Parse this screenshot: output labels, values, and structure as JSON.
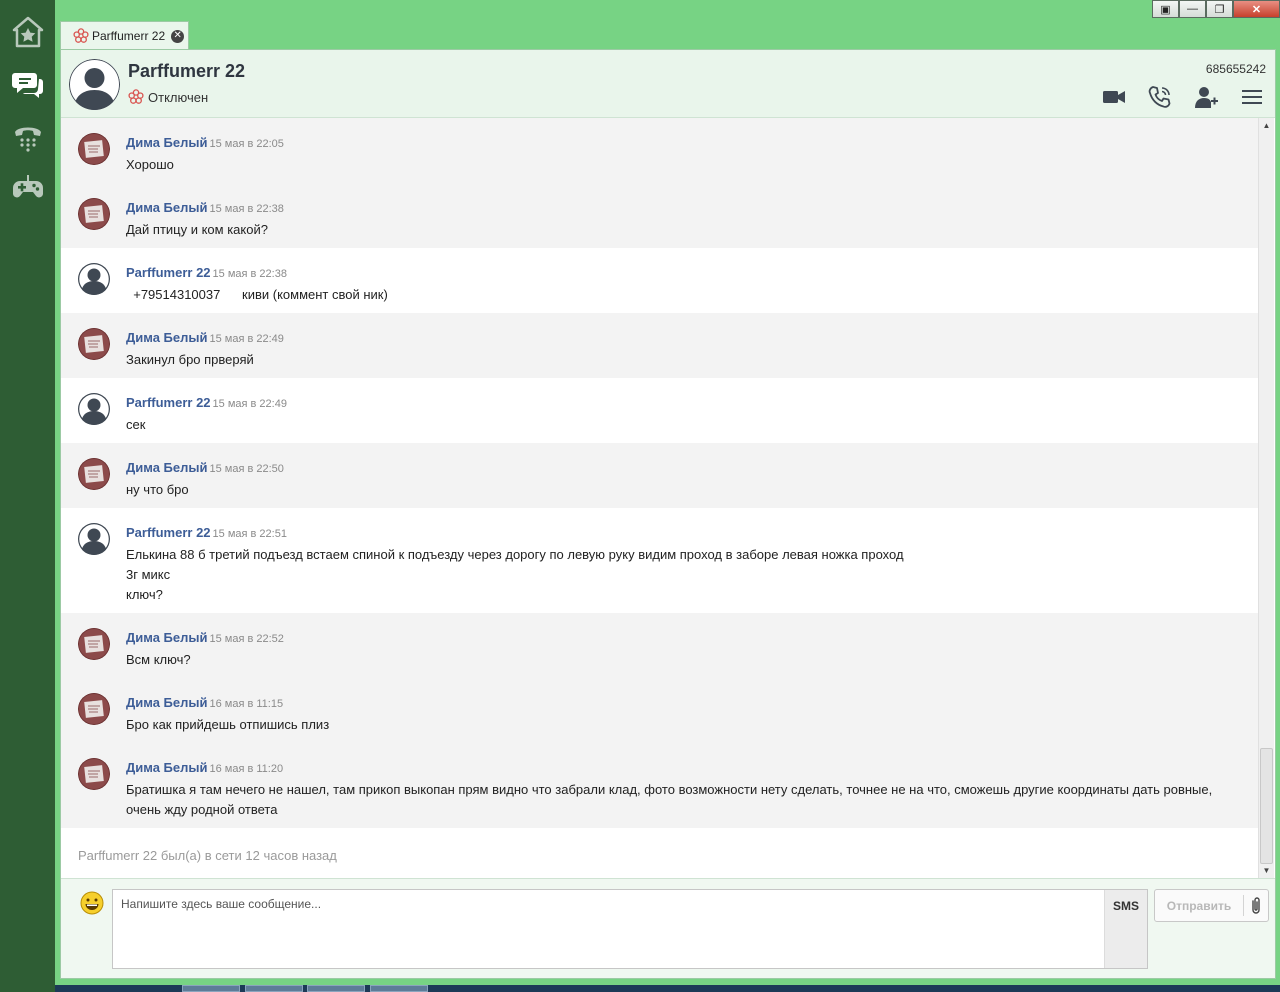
{
  "window": {
    "tab_label": "Parffumerr 22",
    "tab_close_glyph": "✕",
    "controls": [
      "▣",
      "—",
      "❐",
      "✕"
    ]
  },
  "sidebar": {
    "items": [
      {
        "name": "home-icon"
      },
      {
        "name": "chat-icon"
      },
      {
        "name": "phone-icon"
      },
      {
        "name": "gamepad-icon"
      }
    ]
  },
  "header": {
    "name": "Parffumerr 22",
    "status": "Отключен",
    "id": "685655242"
  },
  "messages": [
    {
      "author": "Дима Белый",
      "time": "15 мая в 22:05",
      "lines": [
        "Хорошо"
      ],
      "avatar": "dima"
    },
    {
      "author": "Дима Белый",
      "time": "15 мая в 22:38",
      "lines": [
        "Дай птицу и ком какой?"
      ],
      "avatar": "dima"
    },
    {
      "author": "Parffumerr 22",
      "time": "15 мая в 22:38",
      "lines": [
        "  +79514310037      киви (коммент свой ник)"
      ],
      "avatar": "user"
    },
    {
      "author": "Дима Белый",
      "time": "15 мая в 22:49",
      "lines": [
        "Закинул бро прверяй"
      ],
      "avatar": "dima"
    },
    {
      "author": "Parffumerr 22",
      "time": "15 мая в 22:49",
      "lines": [
        "сек"
      ],
      "avatar": "user"
    },
    {
      "author": "Дима Белый",
      "time": "15 мая в 22:50",
      "lines": [
        "ну что бро"
      ],
      "avatar": "dima"
    },
    {
      "author": "Parffumerr 22",
      "time": "15 мая в 22:51",
      "lines": [
        "Елькина 88 б третий подъезд встаем спиной к подъезду через дорогу по левую руку видим проход в заборе левая ножка проход",
        "3г микс",
        "ключ?"
      ],
      "avatar": "user"
    },
    {
      "author": "Дима Белый",
      "time": "15 мая в 22:52",
      "lines": [
        "Всм ключ?"
      ],
      "avatar": "dima"
    },
    {
      "author": "Дима Белый",
      "time": "16 мая в 11:15",
      "lines": [
        "Бро как прийдешь отпишись плиз"
      ],
      "avatar": "dima"
    },
    {
      "author": "Дима Белый",
      "time": "16 мая в 11:20",
      "lines": [
        "Братишка я там нечего не нашел, там прикоп выкопан прям видно что забрали клад, фото возможности нету сделать, точнее не на что, сможешь другие координаты дать ровные, очень жду родной ответа"
      ],
      "avatar": "dima"
    }
  ],
  "last_seen": "Parffumerr 22 был(а) в сети 12 часов назад",
  "composer": {
    "placeholder": "Напишите здесь ваше сообщение...",
    "sms_label": "SMS",
    "send_label": "Отправить"
  },
  "scrollbar": {
    "position_fraction": 1.0
  },
  "colors": {
    "window_bg": "#77d384",
    "sidebar_bg": "#2e5d34",
    "author": "#3d5d97",
    "header_bg": "#e9f5eb"
  }
}
